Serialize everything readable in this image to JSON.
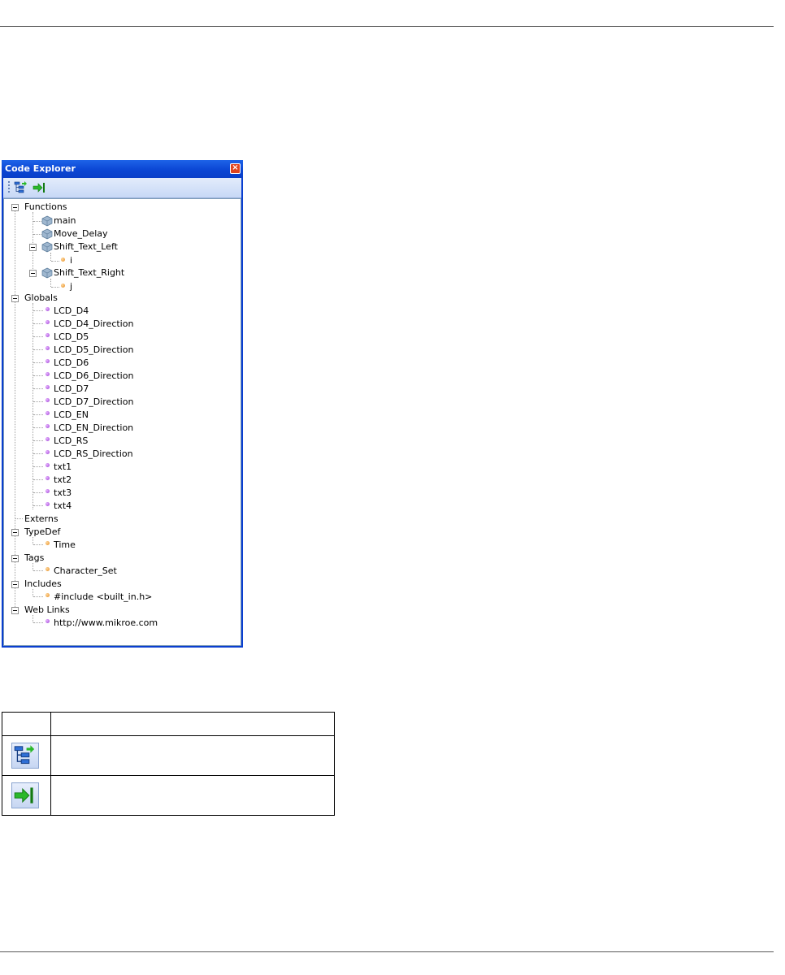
{
  "window": {
    "title": "Code Explorer",
    "close_label": "×"
  },
  "toolbar": {
    "buttons": [
      {
        "name": "expand-collapse-tree-icon"
      },
      {
        "name": "go-to-declaration-icon"
      }
    ]
  },
  "tree": {
    "functions": {
      "label": "Functions",
      "items": [
        "main",
        "Move_Delay",
        "Shift_Text_Left",
        "i",
        "Shift_Text_Right",
        "j"
      ]
    },
    "globals": {
      "label": "Globals",
      "items": [
        "LCD_D4",
        "LCD_D4_Direction",
        "LCD_D5",
        "LCD_D5_Direction",
        "LCD_D6",
        "LCD_D6_Direction",
        "LCD_D7",
        "LCD_D7_Direction",
        "LCD_EN",
        "LCD_EN_Direction",
        "LCD_RS",
        "LCD_RS_Direction",
        "txt1",
        "txt2",
        "txt3",
        "txt4"
      ]
    },
    "externs": {
      "label": "Externs"
    },
    "typedef": {
      "label": "TypeDef",
      "items": [
        "Time"
      ]
    },
    "tags": {
      "label": "Tags",
      "items": [
        "Character_Set"
      ]
    },
    "includes": {
      "label": "Includes",
      "items": [
        "#include <built_in.h>"
      ]
    },
    "weblinks": {
      "label": "Web Links",
      "items": [
        "http://www.mikroe.com"
      ]
    }
  },
  "colors": {
    "title_bar": "#0b46d4",
    "global_dot": "#9b3cd6",
    "local_dot": "#e58a1c"
  }
}
